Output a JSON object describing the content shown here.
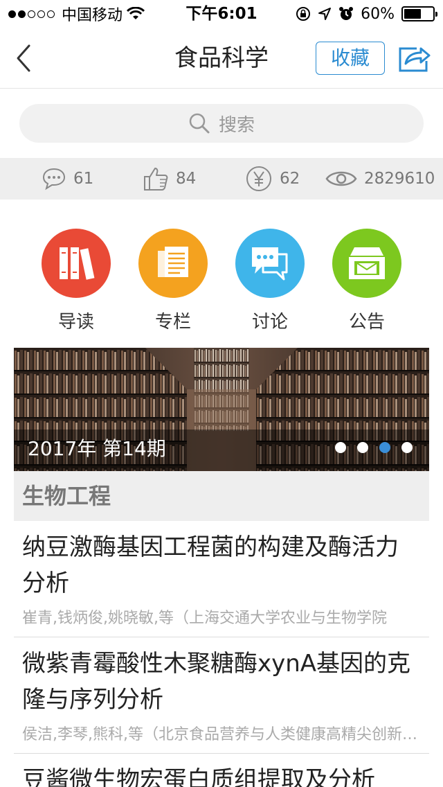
{
  "status_bar": {
    "carrier": "中国移动",
    "time": "下午6:01",
    "battery": "60%",
    "battery_level": 0.6
  },
  "nav": {
    "title": "食品科学",
    "favorite_label": "收藏"
  },
  "search": {
    "placeholder": "搜索"
  },
  "stats": {
    "comments": "61",
    "likes": "84",
    "rewards": "62",
    "views": "2829610"
  },
  "categories": [
    {
      "label": "导读",
      "color": "#e94a36"
    },
    {
      "label": "专栏",
      "color": "#f4a21f"
    },
    {
      "label": "讨论",
      "color": "#3fb5ea"
    },
    {
      "label": "公告",
      "color": "#7dc81f"
    }
  ],
  "banner": {
    "caption": "2017年 第14期",
    "page_count": 4,
    "active_index": 2
  },
  "section": {
    "title": "生物工程"
  },
  "articles": [
    {
      "title": "纳豆激酶基因工程菌的构建及酶活力分析",
      "meta": "崔青,钱炳俊,姚晓敏,等（上海交通大学农业与生物学院"
    },
    {
      "title": "微紫青霉酸性木聚糖酶xynA基因的克隆与序列分析",
      "meta": "侯洁,李琴,熊科,等（北京食品营养与人类健康高精尖创新中心"
    },
    {
      "title": "豆酱微生物宏蛋白质组提取及分析",
      "meta": ""
    }
  ]
}
